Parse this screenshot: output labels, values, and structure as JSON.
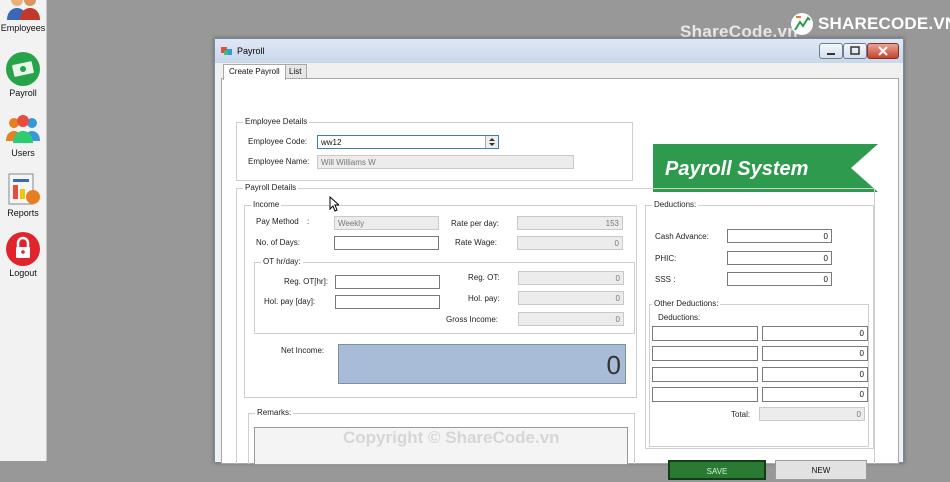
{
  "sidebar": {
    "items": [
      {
        "label": "Employees",
        "icon": "employees-icon"
      },
      {
        "label": "Payroll",
        "icon": "payroll-money-icon"
      },
      {
        "label": "Users",
        "icon": "users-icon"
      },
      {
        "label": "Reports",
        "icon": "reports-icon"
      },
      {
        "label": "Logout",
        "icon": "logout-lock-icon"
      }
    ]
  },
  "watermark": {
    "top_text": "ShareCode.vn",
    "logo_text": "SHARECODE.VN",
    "bottom_text": "Copyright © ShareCode.vn"
  },
  "window": {
    "title": "Payroll",
    "tabs": [
      {
        "label": "Create Payroll",
        "active": true
      },
      {
        "label": "List",
        "active": false
      }
    ]
  },
  "employee_details": {
    "group_title": "Employee Details",
    "code_label": "Employee Code:",
    "code_value": "ww12",
    "name_label": "Employee Name:",
    "name_value": "Will Williams W"
  },
  "brand": {
    "text": "Payroll System",
    "color": "#2e9a4e"
  },
  "payroll_details": {
    "group_title": "Payroll Details",
    "income": {
      "group_title": "Income",
      "pay_method_label": "Pay Method",
      "pay_method_colon": ":",
      "pay_method_value": "Weekly",
      "days_label": "No. of Days:",
      "days_value": "",
      "rate_per_day_label": "Rate per day:",
      "rate_per_day_value": "153",
      "rate_wage_label": "Rate Wage:",
      "rate_wage_value": "0"
    },
    "ot": {
      "group_title": "OT hr/day:",
      "reg_ot_hr_label": "Reg. OT[hr]:",
      "reg_ot_hr_value": "",
      "hol_pay_day_label": "Hol. pay [day]:",
      "hol_pay_day_value": "",
      "reg_ot_label": "Reg. OT:",
      "reg_ot_value": "0",
      "hol_pay_label": "Hol. pay:",
      "hol_pay_value": "0",
      "gross_income_label": "Gross Income:",
      "gross_income_value": "0"
    },
    "net_income_label": "Net Income:",
    "net_income_value": "0"
  },
  "remarks": {
    "group_title": "Remarks:",
    "value": ""
  },
  "deductions": {
    "group_title": "Deductions:",
    "cash_advance_label": "Cash Advance:",
    "cash_advance_value": "0",
    "phic_label": "PHIC:",
    "phic_value": "0",
    "sss_label": "SSS :",
    "sss_value": "0",
    "other": {
      "group_title": "Other Deductions:",
      "sub_label": "Deductions:",
      "rows": [
        {
          "name": "",
          "amount": "0"
        },
        {
          "name": "",
          "amount": "0"
        },
        {
          "name": "",
          "amount": "0"
        },
        {
          "name": "",
          "amount": "0"
        }
      ],
      "total_label": "Total:",
      "total_value": "0"
    }
  },
  "actions": {
    "save_label": "SAVE",
    "new_label": "NEW"
  }
}
